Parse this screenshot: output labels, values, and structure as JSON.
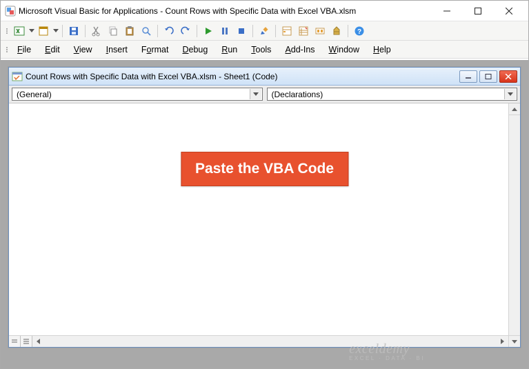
{
  "outer": {
    "title": "Microsoft Visual Basic for Applications - Count Rows with Specific Data with Excel VBA.xlsm"
  },
  "menus": [
    "File",
    "Edit",
    "View",
    "Insert",
    "Format",
    "Debug",
    "Run",
    "Tools",
    "Add-Ins",
    "Window",
    "Help"
  ],
  "codewin": {
    "title": "Count Rows with Specific Data with Excel VBA.xlsm - Sheet1 (Code)",
    "combo_left": "(General)",
    "combo_right": "(Declarations)"
  },
  "callout": "Paste the VBA Code",
  "watermark": {
    "line1": "exceldemy",
    "line2": "EXCEL · DATA · BI"
  }
}
